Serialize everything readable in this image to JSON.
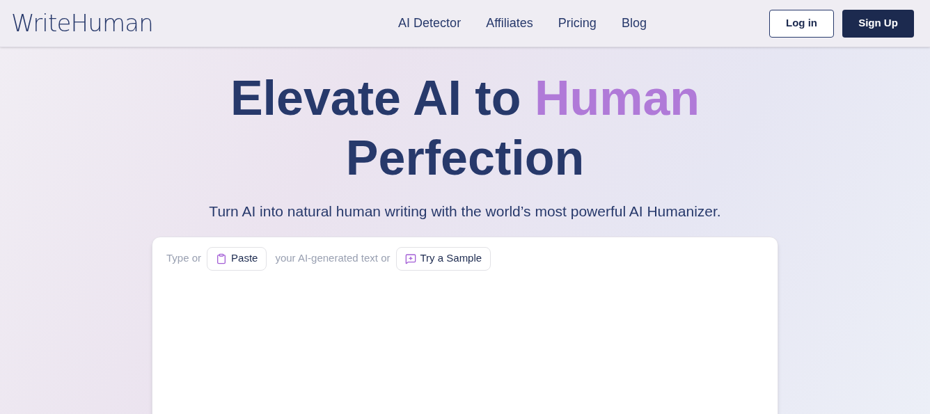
{
  "logo": "WriteHuman",
  "nav": [
    "AI Detector",
    "Affiliates",
    "Pricing",
    "Blog"
  ],
  "auth": {
    "login": "Log in",
    "signup": "Sign Up"
  },
  "headline": {
    "lead": "Elevate AI to",
    "accent": "Human",
    "tail": "Perfection"
  },
  "subtitle": "Turn AI into natural human writing with the world’s most powerful AI Humanizer.",
  "editor": {
    "prefix": "Type or",
    "paste": "Paste",
    "middle": "your AI-generated text or",
    "sample": "Try a Sample"
  }
}
